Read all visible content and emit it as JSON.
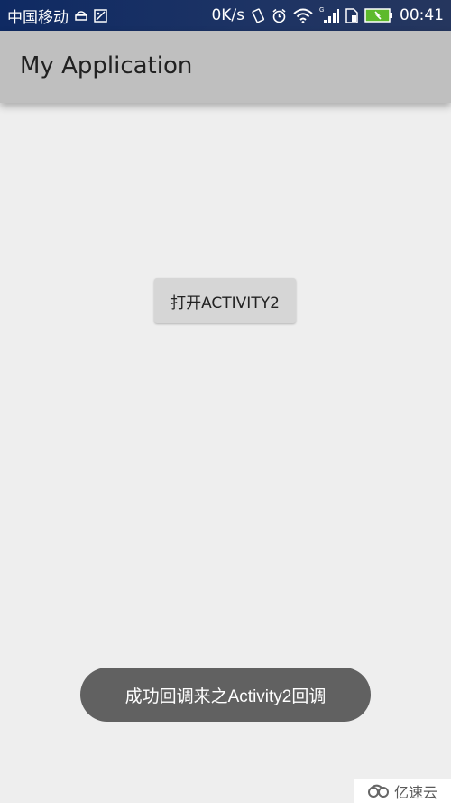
{
  "status_bar": {
    "carrier": "中国移动",
    "net_speed": "0K/s",
    "signal_label": "G",
    "time": "00:41",
    "icons": [
      "android-debug-icon",
      "image-icon",
      "vibrate-icon",
      "alarm-icon",
      "wifi-icon",
      "cell-signal-icon",
      "sim-icon",
      "battery-charging-icon"
    ]
  },
  "app_bar": {
    "title": "My Application"
  },
  "main": {
    "open_button_label": "打开ACTIVITY2"
  },
  "toast": {
    "message": "成功回调来之Activity2回调"
  },
  "watermark": {
    "text": "亿速云"
  }
}
